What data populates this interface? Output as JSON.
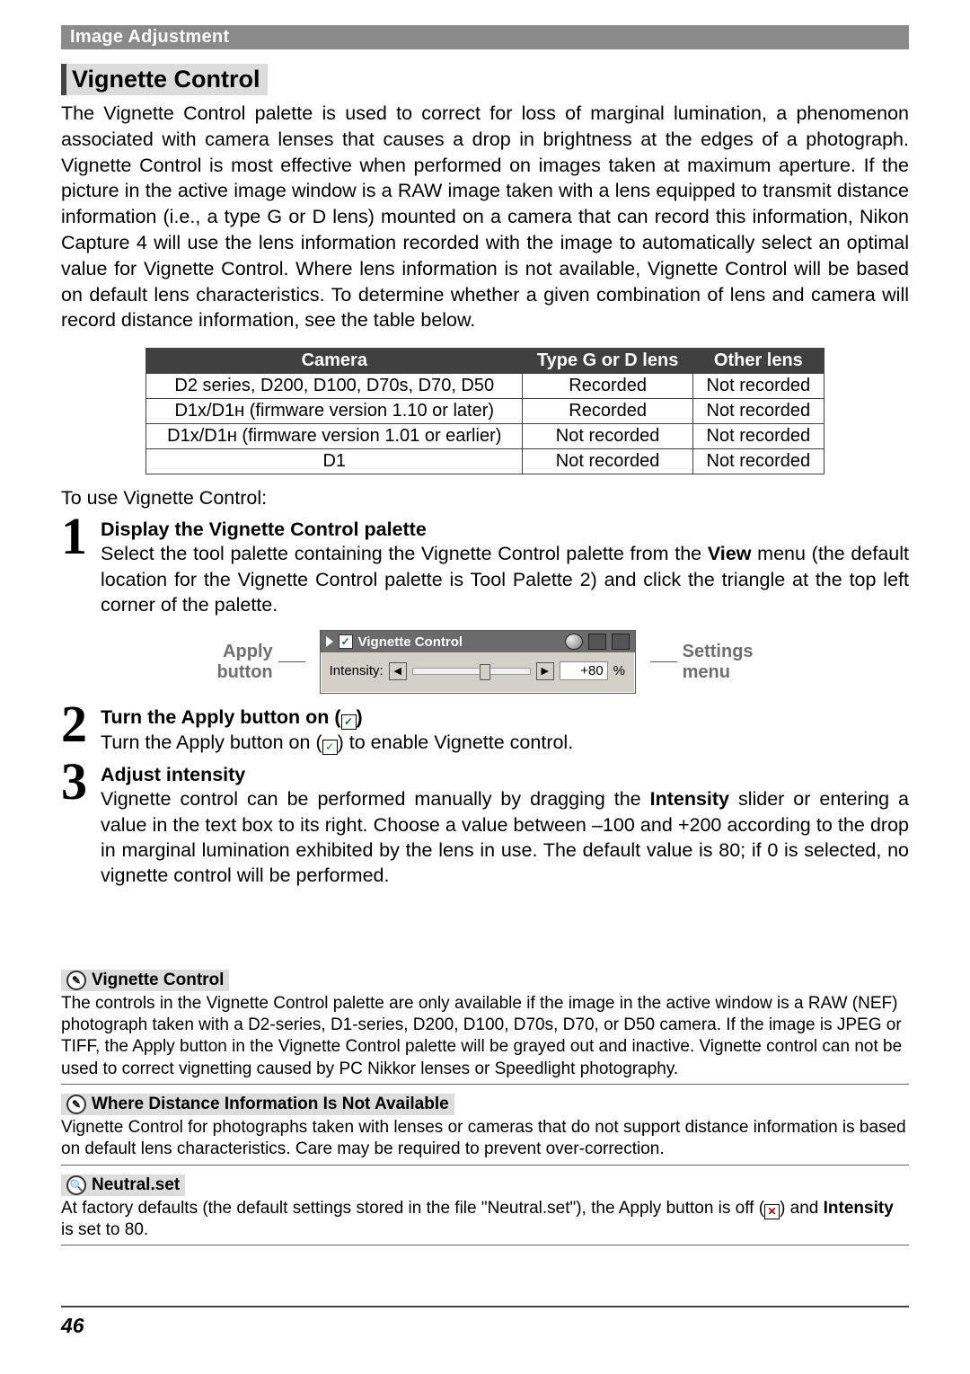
{
  "header_bar": "Image Adjustment",
  "section_title": "Vignette Control",
  "intro": "The Vignette Control palette is used to correct for loss of marginal lumination, a phenomenon associated with camera lenses that causes a drop in brightness at the edges of a photograph. Vignette Control is most effective when performed on images taken at maximum aperture.  If the picture in the active image window is a RAW image taken with a lens equipped to transmit distance information (i.e., a type G or D lens) mounted on a camera that can record this information, Nikon Capture 4 will use the lens information recorded with the image to automatically select an optimal value for Vignette Control.  Where lens information is not available, Vignette Control will be based on default lens characteristics.  To determine whether a given combination of lens and camera will record distance information, see the table below.",
  "table": {
    "headers": {
      "c1": "Camera",
      "c2": "Type G or D lens",
      "c3": "Other lens"
    },
    "rows": [
      {
        "c1": "D2 series, D200, D100, D70s, D70, D50",
        "c2": "Recorded",
        "c3": "Not recorded"
      },
      {
        "c1": "D1x/D1ʜ (firmware version 1.10 or later)",
        "c2": "Recorded",
        "c3": "Not recorded"
      },
      {
        "c1": "D1x/D1ʜ (firmware version 1.01 or earlier)",
        "c2": "Not recorded",
        "c3": "Not recorded"
      },
      {
        "c1": "D1",
        "c2": "Not recorded",
        "c3": "Not recorded"
      }
    ]
  },
  "steps_lead": "To use Vignette Control:",
  "steps": [
    {
      "num": "1",
      "title": "Display the Vignette Control palette",
      "body_before": "Select the tool palette containing the Vignette Control palette from the ",
      "body_bold": "View",
      "body_after": " menu (the default location for the Vignette Control palette is Tool Palette 2) and click the triangle at the top left corner of the palette."
    },
    {
      "num": "2",
      "title": "Turn the Apply button on (",
      "body_before": "Turn the Apply button on (",
      "body_after": ") to enable Vignette control."
    },
    {
      "num": "3",
      "title": "Adjust intensity",
      "body_before": "Vignette control can be performed manually by dragging the ",
      "body_bold": "Intensity",
      "body_after": " slider or entering a value in the text box to its right.  Choose a value between –100 and +200 according to the drop in marginal lumination exhibited by the lens in use.  The default value is 80; if 0 is selected, no vignette control will be performed."
    }
  ],
  "figure": {
    "left_label_l1": "Apply",
    "left_label_l2": "button",
    "right_label_l1": "Settings",
    "right_label_l2": "menu",
    "palette_title": "Vignette Control",
    "intensity_label": "Intensity:",
    "intensity_value": "+80",
    "intensity_unit": "%"
  },
  "notes": [
    {
      "icon": "pencil",
      "title": "Vignette Control",
      "body": "The controls in the Vignette Control palette are only available if the image in the active window is a RAW (NEF) photograph taken with a D2-series, D1-series, D200, D100, D70s, D70, or D50 camera.  If the image is JPEG or TIFF, the Apply button in the Vignette Control palette will be grayed out and inactive.  Vignette control can not be used to correct vignetting caused by PC Nikkor lenses or Speedlight photography."
    },
    {
      "icon": "pencil",
      "title": "Where Distance Information Is Not Available",
      "body": "Vignette Control for photographs taken with lenses or cameras that do not support distance information is based on default lens characteristics.  Care may be required to prevent over-correction."
    },
    {
      "icon": "magnifier",
      "title": "Neutral.set",
      "body_before": "At factory defaults (the default settings stored in the file \"Neutral.set\"), the Apply button is off (",
      "body_after": ") and ",
      "bold_tail": "Intensity",
      "tail2": " is set to 80."
    }
  ],
  "page_number": "46"
}
